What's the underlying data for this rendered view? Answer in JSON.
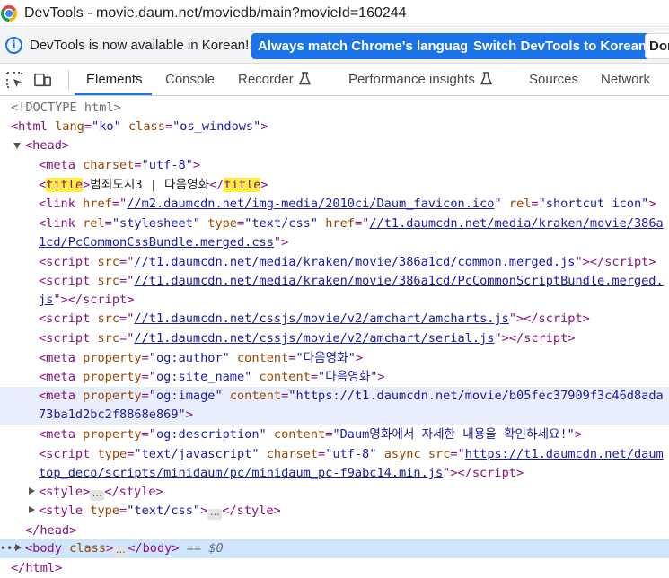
{
  "window": {
    "title": "DevTools - movie.daum.net/moviedb/main?movieId=160244"
  },
  "infobar": {
    "message": "DevTools is now available in Korean!",
    "btn_match": "Always match Chrome's language",
    "btn_switch": "Switch DevTools to Korean",
    "btn_dont": "Don't show again"
  },
  "tabs": {
    "elements": "Elements",
    "console": "Console",
    "recorder": "Recorder",
    "performance": "Performance insights",
    "sources": "Sources",
    "network": "Network"
  },
  "dom": {
    "doctype": "<!DOCTYPE html>",
    "html_lang": "\"ko\"",
    "html_class": "\"os_windows\"",
    "meta_charset": "\"utf-8\"",
    "title_text": "범죄도시3 | 다음영화",
    "link1_href": "//m2.daumcdn.net/img-media/2010ci/Daum_favicon.ico",
    "link1_rel": "\"shortcut icon\"",
    "link2_rel": "\"stylesheet\"",
    "link2_type": "\"text/css\"",
    "link2_href_a": "//t1.daumcdn.net/media/kraken/movie/386a",
    "link2_href_b": "1cd/PcCommonCssBundle.merged.css",
    "script1_src": "//t1.daumcdn.net/media/kraken/movie/386a1cd/common.merged.js",
    "script2_src_a": "//t1.daumcdn.net/media/kraken/movie/386a1cd/PcCommonScriptBundle.merged.",
    "script2_src_b": "js",
    "script3_src": "//t1.daumcdn.net/cssjs/movie/v2/amchart/amcharts.js",
    "script4_src": "//t1.daumcdn.net/cssjs/movie/v2/amchart/serial.js",
    "og_author_prop": "\"og:author\"",
    "og_author_content": "\"다음영화\"",
    "og_site_prop": "\"og:site_name\"",
    "og_site_content": "\"다음영화\"",
    "og_image_prop": "\"og:image\"",
    "og_image_content_a": "\"https://t1.daumcdn.net/movie/b05fec37909f3c46d8ada",
    "og_image_content_b": "73ba1d2bc2f8868e869\"",
    "og_desc_prop": "\"og:description\"",
    "og_desc_content": "\"Daum영화에서 자세한 내용을 확인하세요!\"",
    "script5_type": "\"text/javascript\"",
    "script5_charset": "\"utf-8\"",
    "script5_src_a": "https://t1.daumcdn.net/daum",
    "script5_src_b": "top_deco/scripts/minidaum/pc/minidaum_pc-f9abc14.min.js",
    "style2_type": "\"text/css\"",
    "selected_marker": "== $0"
  }
}
